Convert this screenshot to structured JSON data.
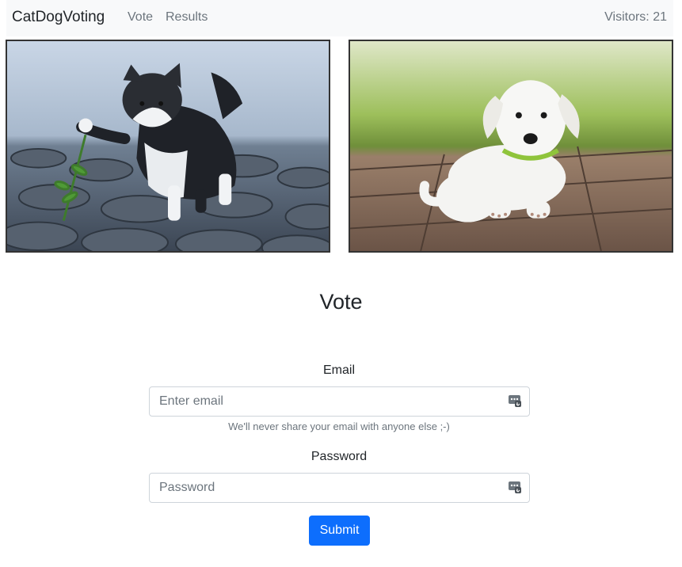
{
  "navbar": {
    "brand": "CatDogVoting",
    "links": [
      {
        "label": "Vote"
      },
      {
        "label": "Results"
      }
    ],
    "visitors": "Visitors: 21"
  },
  "images": [
    {
      "subject": "kitten"
    },
    {
      "subject": "puppy"
    }
  ],
  "form": {
    "title": "Vote",
    "email_label": "Email",
    "email_placeholder": "Enter email",
    "email_value": "",
    "email_help": "We'll never share your email with anyone else ;-)",
    "password_label": "Password",
    "password_placeholder": "Password",
    "password_value": "",
    "submit_label": "Submit",
    "field_icon": "password-manager-key-icon"
  },
  "colors": {
    "navbar_bg": "#f8f9fa",
    "primary": "#0d6efd",
    "muted": "#6c757d"
  }
}
